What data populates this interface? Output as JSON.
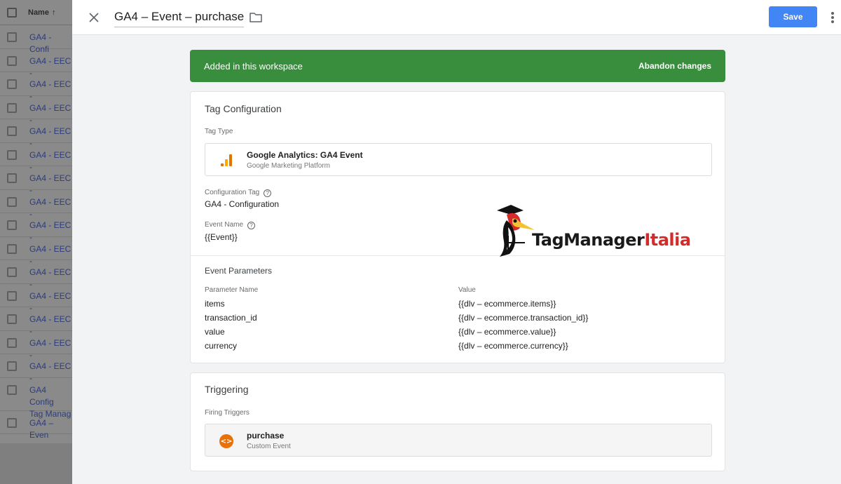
{
  "background_list": {
    "header_label": "Name",
    "sort_arrow": "↑",
    "rows": [
      "GA4 - Confi",
      "GA4 - EEC -",
      "GA4 - EEC -",
      "GA4 - EEC -",
      "GA4 - EEC -",
      "GA4 - EEC -",
      "GA4 - EEC -",
      "GA4 - EEC -",
      "GA4 - EEC -",
      "GA4 - EEC -",
      "GA4 - EEC -",
      "GA4 - EEC -",
      "GA4 - EEC -",
      "GA4 - EEC -",
      "GA4 - EEC -",
      "GA4 Config\nTag Manag",
      "GA4 – Even"
    ]
  },
  "header": {
    "title": "GA4 – Event – purchase",
    "save_label": "Save"
  },
  "banner": {
    "text": "Added in this workspace",
    "abandon_label": "Abandon changes"
  },
  "tag_config": {
    "title": "Tag Configuration",
    "tag_type_label": "Tag Type",
    "tag_type_name": "Google Analytics: GA4 Event",
    "tag_type_sub": "Google Marketing Platform",
    "config_tag_label": "Configuration Tag",
    "config_tag_value": "GA4 - Configuration",
    "event_name_label": "Event Name",
    "event_name_value": "{{Event}}",
    "event_params_title": "Event Parameters",
    "param_col": "Parameter Name",
    "value_col": "Value",
    "params": [
      {
        "name": "items",
        "value": "{{dlv – ecommerce.items}}"
      },
      {
        "name": "transaction_id",
        "value": "{{dlv – ecommerce.transaction_id}}"
      },
      {
        "name": "value",
        "value": "{{dlv – ecommerce.value}}"
      },
      {
        "name": "currency",
        "value": "{{dlv – ecommerce.currency}}"
      }
    ]
  },
  "triggering": {
    "title": "Triggering",
    "firing_label": "Firing Triggers",
    "trigger_name": "purchase",
    "trigger_type": "Custom Event"
  },
  "watermark": {
    "brand_main": "TagManager",
    "brand_accent": "Italia"
  },
  "icons": {
    "close": "close-icon",
    "folder": "folder-icon",
    "more": "more-vert-icon",
    "ga": "google-analytics-icon",
    "trigger": "custom-event-icon",
    "help": "help-icon"
  },
  "colors": {
    "save": "#4285f4",
    "banner": "#388e3c",
    "trigger_icon": "#e8710a",
    "ga_bar_dark": "#e37400",
    "ga_bar_light": "#f9ab00",
    "brand_accent": "#d62b2b"
  }
}
